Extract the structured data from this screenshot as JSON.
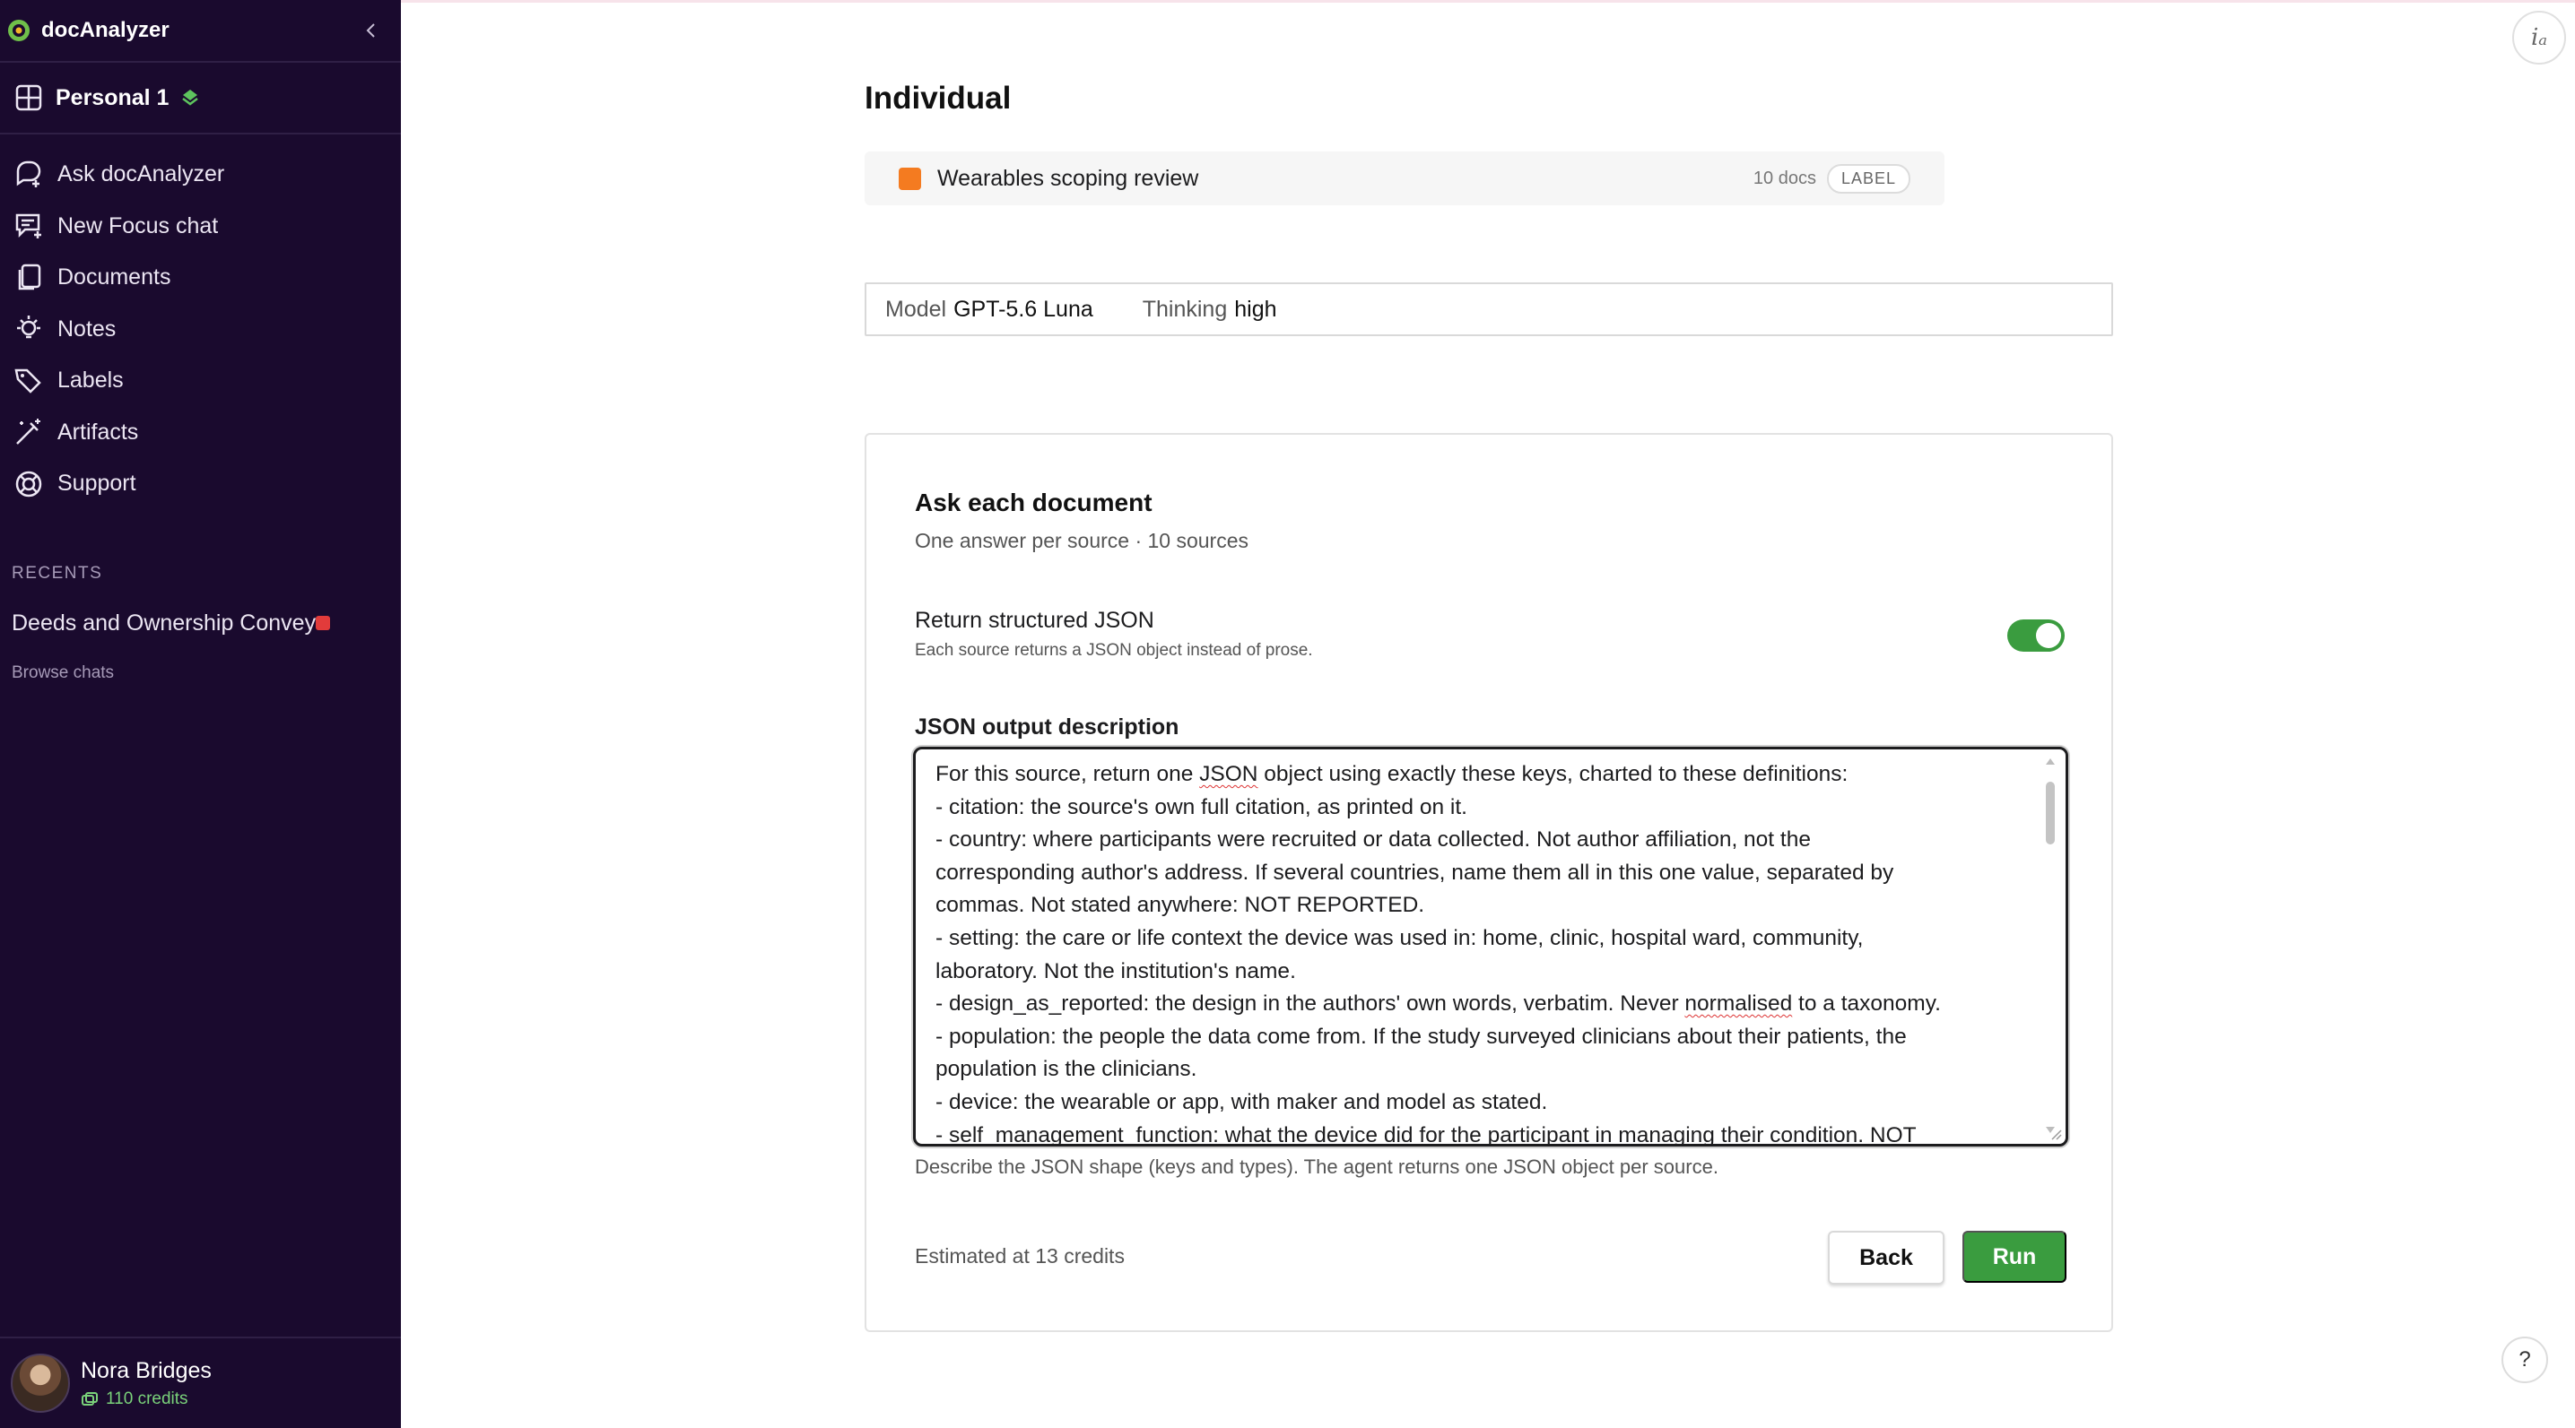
{
  "app": {
    "name": "docAnalyzer"
  },
  "workspace": {
    "name": "Personal 1"
  },
  "nav": [
    {
      "label": "Ask docAnalyzer",
      "icon": "ask-chat-icon"
    },
    {
      "label": "New Focus chat",
      "icon": "focus-chat-icon"
    },
    {
      "label": "Documents",
      "icon": "documents-icon"
    },
    {
      "label": "Notes",
      "icon": "lightbulb-icon"
    },
    {
      "label": "Labels",
      "icon": "tags-icon"
    },
    {
      "label": "Artifacts",
      "icon": "wand-icon"
    },
    {
      "label": "Support",
      "icon": "lifebuoy-icon"
    }
  ],
  "recents": {
    "heading": "RECENTS",
    "items": [
      {
        "label": "Deeds and Ownership Convey"
      }
    ],
    "browse_label": "Browse chats"
  },
  "user": {
    "name": "Nora Bridges",
    "credits": "110 credits"
  },
  "main": {
    "title": "Individual",
    "label_row": {
      "name": "Wearables scoping review",
      "docs": "10 docs",
      "tag": "LABEL",
      "color": "#f47b20"
    },
    "model": {
      "model_key": "Model",
      "model_value": "GPT-5.6 Luna",
      "thinking_key": "Thinking",
      "thinking_value": "high"
    },
    "card": {
      "title": "Ask each document",
      "subtitle": "One answer per source · 10 sources",
      "toggle_label": "Return structured JSON",
      "toggle_help": "Each source returns a JSON object instead of prose.",
      "toggle_on": true,
      "field_label": "JSON output description",
      "textarea_lines": [
        "For this source, return one JSON object using exactly these keys, charted to these definitions:",
        "- citation: the source's own full citation, as printed on it.",
        "- country: where participants were recruited or data collected. Not author affiliation, not the",
        "corresponding author's address. If several countries, name them all in this one value, separated by",
        "commas. Not stated anywhere: NOT REPORTED.",
        "- setting: the care or life context the device was used in: home, clinic, hospital ward, community,",
        "laboratory. Not the institution's name.",
        "- design_as_reported: the design in the authors' own words, verbatim. Never normalised to a taxonomy.",
        "- population: the people the data come from. If the study surveyed clinicians about their patients, the",
        "population is the clinicians.",
        "- device: the wearable or app, with maker and model as stated.",
        "- self_management_function: what the device did for the participant in managing their condition. NOT"
      ],
      "field_help": "Describe the JSON shape (keys and types). The agent returns one JSON object per source.",
      "estimate": "Estimated at 13 credits",
      "back_label": "Back",
      "run_label": "Run"
    }
  },
  "colors": {
    "sidebar": "#1a0a2e",
    "accent_green": "#3a9c3f",
    "label_orange": "#f47b20",
    "recent_dot": "#e23b3b"
  }
}
